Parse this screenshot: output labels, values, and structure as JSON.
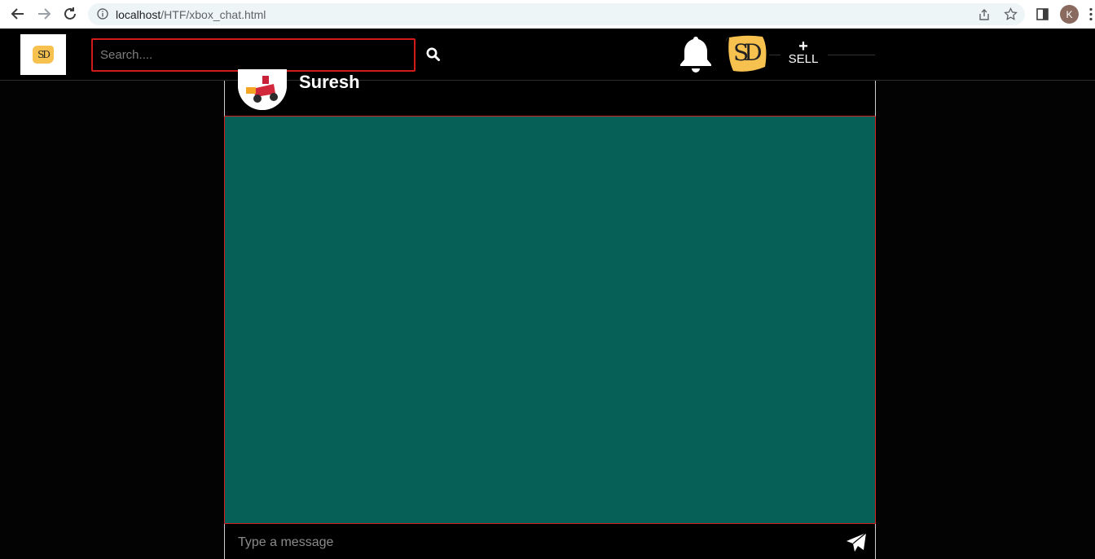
{
  "browser": {
    "url_host": "localhost",
    "url_path": "/HTF/xbox_chat.html",
    "profile_initial": "K"
  },
  "header": {
    "logo_text": "SD",
    "search_placeholder": "Search....",
    "profile_logo_text": "SD",
    "sell_plus": "+",
    "sell_label": "SELL"
  },
  "chat": {
    "contact_name": "Suresh",
    "message_placeholder": "Type a message"
  },
  "colors": {
    "chat_background": "#076058",
    "accent_red": "#d11b1b",
    "logo_yellow": "#f6c14f"
  }
}
